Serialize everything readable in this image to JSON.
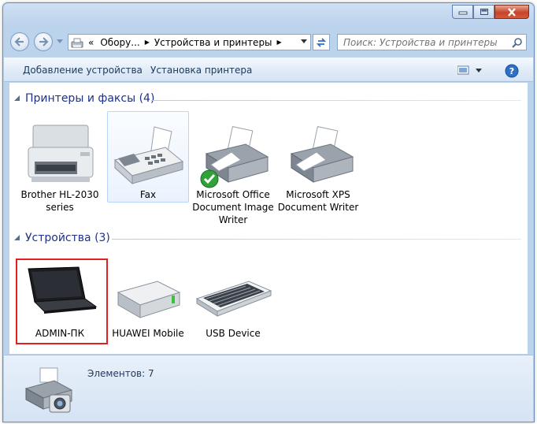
{
  "window": {
    "minimize_icon": "minimize-icon",
    "maximize_icon": "maximize-icon",
    "close_icon": "close-icon"
  },
  "address_bar": {
    "overflow": "«",
    "segments": [
      "Обору...",
      "Устройства и принтеры"
    ]
  },
  "search": {
    "placeholder": "Поиск: Устройства и принтеры"
  },
  "toolbar": {
    "add_device": "Добавление устройства",
    "add_printer": "Установка принтера"
  },
  "groups": {
    "printers": {
      "title": "Принтеры и факсы (4)",
      "items": [
        {
          "label_lines": [
            "Brother HL-2030",
            "series"
          ],
          "icon": "laser-printer-icon"
        },
        {
          "label_lines": [
            "Fax"
          ],
          "icon": "fax-icon",
          "selected": true
        },
        {
          "label_lines": [
            "Microsoft Office",
            "Document Image",
            "Writer"
          ],
          "icon": "printer-icon",
          "default": true
        },
        {
          "label_lines": [
            "Microsoft XPS",
            "Document Writer"
          ],
          "icon": "printer-icon"
        }
      ]
    },
    "devices": {
      "title": "Устройства (3)",
      "items": [
        {
          "label_lines": [
            "ADMIN-ПК"
          ],
          "icon": "laptop-icon",
          "highlighted": true
        },
        {
          "label_lines": [
            "HUAWEI Mobile"
          ],
          "icon": "external-drive-icon"
        },
        {
          "label_lines": [
            "USB Device"
          ],
          "icon": "keyboard-icon"
        }
      ]
    }
  },
  "status": {
    "text": "Элементов: 7",
    "icon": "devices-printers-icon"
  },
  "colors": {
    "group_header": "#1e3287",
    "highlight_box": "#e02020",
    "selection_border": "#b8d6fb"
  }
}
